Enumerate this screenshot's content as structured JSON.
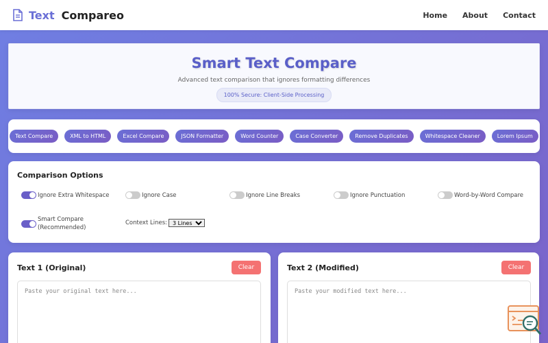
{
  "nav": {
    "logo_part1": "Text",
    "logo_part2": "Compareo",
    "links": [
      "Home",
      "About",
      "Contact"
    ]
  },
  "hero": {
    "title": "Smart Text Compare",
    "subtitle": "Advanced text comparison that ignores formatting differences",
    "badge": "100% Secure: Client-Side Processing"
  },
  "tools": [
    "Text Compare",
    "XML to HTML",
    "Excel Compare",
    "JSON Formatter",
    "Word Counter",
    "Case Converter",
    "Remove Duplicates",
    "Whitespace Cleaner",
    "Lorem Ipsum"
  ],
  "options": {
    "title": "Comparison Options",
    "items": [
      {
        "label": "Ignore Extra Whitespace",
        "on": true
      },
      {
        "label": "Ignore Case",
        "on": false
      },
      {
        "label": "Ignore Line Breaks",
        "on": false
      },
      {
        "label": "Ignore Punctuation",
        "on": false
      },
      {
        "label": "Word-by-Word Compare",
        "on": false
      }
    ],
    "smart_line1": "Smart Compare",
    "smart_line2": "(Recommended)",
    "smart_on": true,
    "context_label": "Context Lines:",
    "context_value": "3 Lines"
  },
  "panels": {
    "left": {
      "title": "Text 1 (Original)",
      "clear": "Clear",
      "placeholder": "Paste your original text here..."
    },
    "right": {
      "title": "Text 2 (Modified)",
      "clear": "Clear",
      "placeholder": "Paste your modified text here..."
    }
  },
  "colors": {
    "accent": "#6a6fd6",
    "danger": "#f47272"
  },
  "icons": {
    "logo": "document-icon",
    "widget": "search-text-icon"
  }
}
